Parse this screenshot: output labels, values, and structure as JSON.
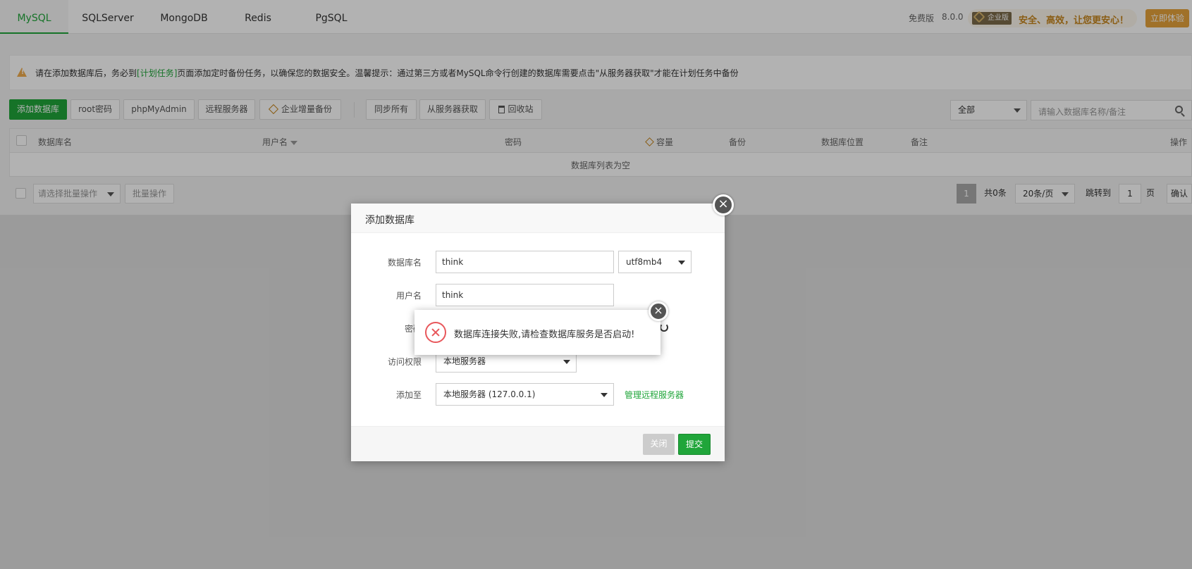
{
  "tabs": [
    {
      "label": "MySQL",
      "active": true
    },
    {
      "label": "SQLServer",
      "active": false
    },
    {
      "label": "MongoDB",
      "active": false
    },
    {
      "label": "Redis",
      "active": false
    },
    {
      "label": "PgSQL",
      "active": false
    }
  ],
  "header": {
    "edition": "免费版",
    "version": "8.0.0",
    "promo_badge": "企业版",
    "promo_text": "安全、高效，让您更安心！",
    "try_button": "立即体验"
  },
  "warning": {
    "prefix": "请在添加数据库后，务必到",
    "link": "[计划任务]",
    "suffix": "页面添加定时备份任务，以确保您的数据安全。温馨提示：通过第三方或者MySQL命令行创建的数据库需要点击\"从服务器获取\"才能在计划任务中备份"
  },
  "toolbar": {
    "add_db": "添加数据库",
    "root_pwd": "root密码",
    "phpmyadmin": "phpMyAdmin",
    "remote_server": "远程服务器",
    "enterprise_backup": "企业增量备份",
    "sync_all": "同步所有",
    "fetch_from_server": "从服务器获取",
    "recycle_bin": "回收站",
    "filter_value": "全部",
    "search_placeholder": "请输入数据库名称/备注"
  },
  "table": {
    "columns": [
      "数据库名",
      "用户名",
      "密码",
      "容量",
      "备份",
      "数据库位置",
      "备注",
      "操作"
    ],
    "empty_text": "数据库列表为空"
  },
  "bottom": {
    "batch_placeholder": "请选择批量操作",
    "batch_button": "批量操作",
    "page_current": "1",
    "total": "共0条",
    "per_page": "20条/页",
    "jump_label": "跳转到",
    "jump_value": "1",
    "page_unit": "页",
    "confirm": "确认"
  },
  "modal": {
    "title": "添加数据库",
    "close_symbol": "×",
    "db_name_label": "数据库名",
    "db_name_value": "think",
    "charset_value": "utf8mb4",
    "username_label": "用户名",
    "username_value": "think",
    "password_label": "密码",
    "access_label": "访问权限",
    "access_value": "本地服务器",
    "add_to_label": "添加至",
    "add_to_value": "本地服务器 (127.0.0.1)",
    "manage_remote_link": "管理远程服务器",
    "close_button": "关闭",
    "submit_button": "提交"
  },
  "alert": {
    "message": "数据库连接失败,请检查数据库服务是否启动!",
    "close_symbol": "×"
  }
}
